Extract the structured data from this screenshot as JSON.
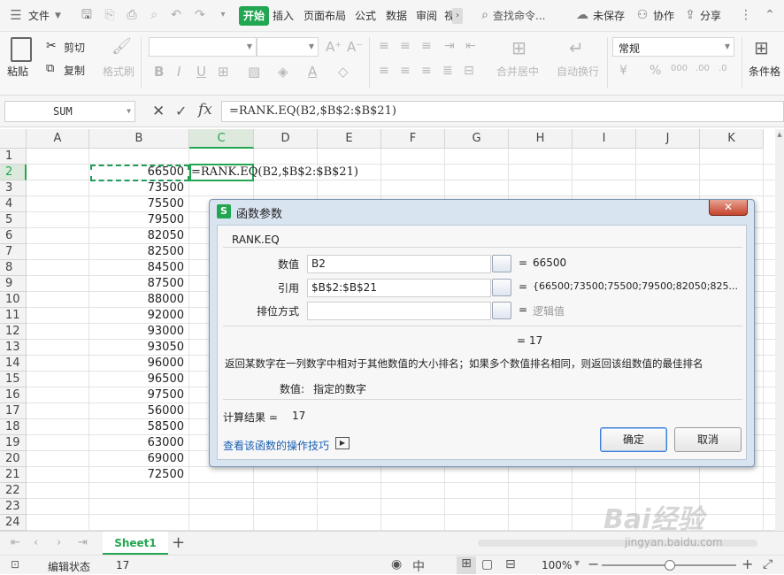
{
  "menubar": {
    "file": "文件",
    "tabs": [
      "开始",
      "插入",
      "页面布局",
      "公式",
      "数据",
      "审阅",
      "视"
    ],
    "active_tab": "开始",
    "search": "查找命令...",
    "unsaved": "未保存",
    "collab": "协作",
    "share": "分享"
  },
  "ribbon": {
    "paste": "粘贴",
    "cut": "剪切",
    "copy": "复制",
    "format_painter": "格式刷",
    "merge_center": "合并居中",
    "wrap_text": "自动换行",
    "number_format": "常规",
    "conditional_format": "条件格",
    "currency_symbol": "¥",
    "percent_symbol": "%"
  },
  "formula_bar": {
    "name_box": "SUM",
    "formula": "=RANK.EQ(B2,$B$2:$B$21)"
  },
  "columns": [
    "A",
    "B",
    "C",
    "D",
    "E",
    "F",
    "G",
    "H",
    "I",
    "J",
    "K"
  ],
  "rows": [
    "1",
    "2",
    "3",
    "4",
    "5",
    "6",
    "7",
    "8",
    "9",
    "10",
    "11",
    "12",
    "13",
    "14",
    "15",
    "16",
    "17",
    "18",
    "19",
    "20",
    "21",
    "22",
    "23",
    "24"
  ],
  "column_b": [
    "",
    "66500",
    "73500",
    "75500",
    "79500",
    "82050",
    "82500",
    "84500",
    "87500",
    "88000",
    "92000",
    "93000",
    "93050",
    "96000",
    "96500",
    "97500",
    "56000",
    "58500",
    "63000",
    "69000",
    "72500",
    "",
    "",
    ""
  ],
  "active_cell_text": "=RANK.EQ(B2,$B$2:$B$21)",
  "dialog": {
    "title": "函数参数",
    "function_name": "RANK.EQ",
    "args": [
      {
        "label": "数值",
        "value": "B2",
        "result": "66500"
      },
      {
        "label": "引用",
        "value": "$B$2:$B$21",
        "result": "{66500;73500;75500;79500;82050;825..."
      },
      {
        "label": "排位方式",
        "value": "",
        "result": "逻辑值"
      }
    ],
    "formula_result_line": "17",
    "description": "返回某数字在一列数字中相对于其他数值的大小排名；如果多个数值排名相同，则返回该组数值的最佳排名",
    "arg_help_label": "数值:",
    "arg_help_text": "指定的数字",
    "calc_result_label": "计算结果 =",
    "calc_result_value": "17",
    "help_link": "查看该函数的操作技巧",
    "ok": "确定",
    "cancel": "取消",
    "equals": "="
  },
  "sheet_tab": "Sheet1",
  "status": {
    "mode": "编辑状态",
    "value": "17",
    "zoom": "100%"
  },
  "watermark": {
    "brand": "Bai经验",
    "url": "jingyan.baidu.com"
  },
  "colors": {
    "accent": "#23a651",
    "link": "#1a5fb4",
    "dialog_frame": "#d9e4f1"
  }
}
